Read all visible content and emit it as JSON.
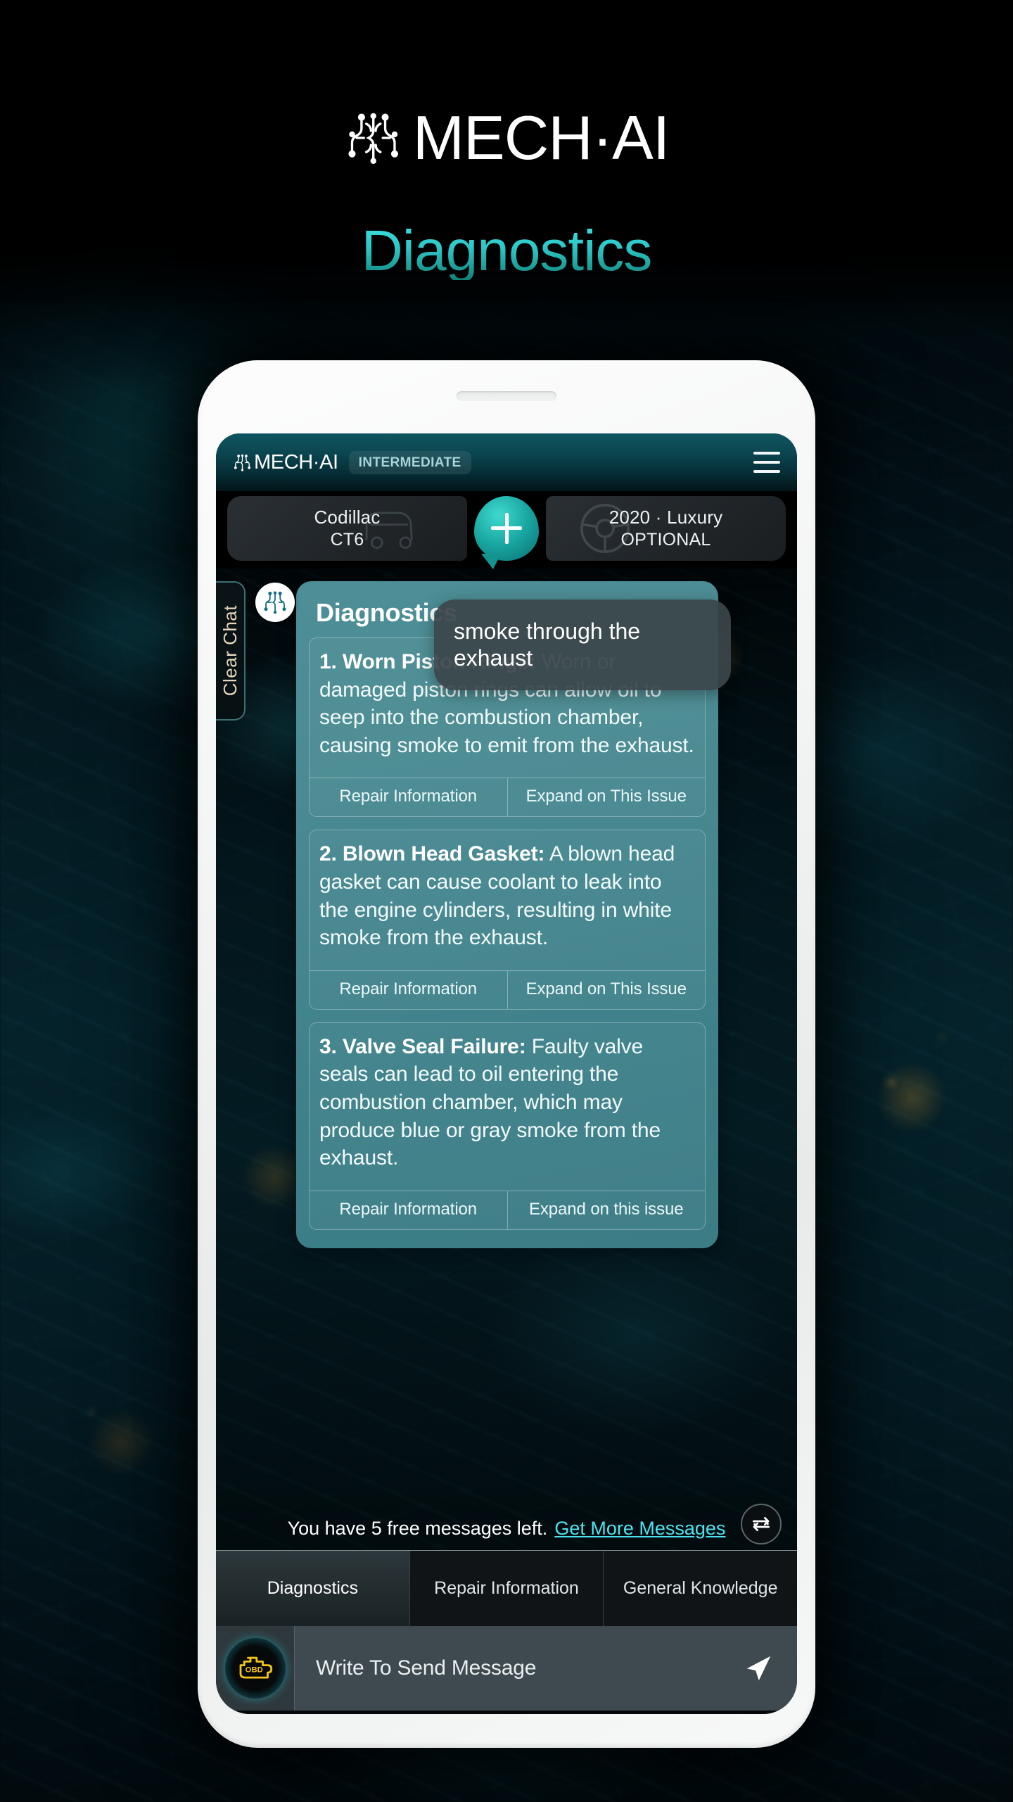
{
  "page": {
    "brand_name": "MECH·AI",
    "brand_icon": "circuit-logo-icon",
    "subtitle": "Diagnostics"
  },
  "app": {
    "header": {
      "logo_text": "MECH·AI",
      "logo_icon": "circuit-logo-icon",
      "level_badge": "INTERMEDIATE",
      "menu_icon": "hamburger-menu-icon"
    },
    "vehicle": {
      "make": "Codillac",
      "model": "CT6",
      "year_trim": "2020 · Luxury",
      "optional": "OPTIONAL",
      "add_icon": "plus-icon"
    },
    "chat": {
      "clear_chat_label": "Clear Chat",
      "avatar_icon": "circuit-logo-icon",
      "bot_title": "Diagnostics",
      "user_message": "smoke through the exhaust",
      "cards": [
        {
          "index": "1.",
          "title": "Worn Piston Rings:",
          "text": "Worn or damaged piston rings can allow oil to seep into the combustion chamber, causing smoke to emit from the exhaust.",
          "btn_left": "Repair Information",
          "btn_right": "Expand on This Issue"
        },
        {
          "index": "2.",
          "title": "Blown Head Gasket:",
          "text": "A blown head gasket can cause coolant to leak into the engine cylinders, resulting in white smoke from the exhaust.",
          "btn_left": "Repair Information",
          "btn_right": "Expand on This Issue"
        },
        {
          "index": "3.",
          "title": "Valve Seal Failure:",
          "text": "Faulty valve seals can lead to oil entering the combustion chamber, which may produce blue or gray smoke from the exhaust.",
          "btn_left": "Repair Information",
          "btn_right": "Expand on this issue"
        }
      ]
    },
    "quota": {
      "text": "You have 5 free messages left.",
      "link": "Get More Messages",
      "refresh_icon": "refresh-icon"
    },
    "tabs": [
      {
        "label": "Diagnostics",
        "active": true
      },
      {
        "label": "Repair Information",
        "active": false
      },
      {
        "label": "General Knowledge",
        "active": false
      }
    ],
    "composer": {
      "obd_icon": "obd-check-engine-icon",
      "obd_label": "OBD",
      "placeholder": "Write To Send Message",
      "send_icon": "send-icon"
    }
  },
  "colors": {
    "accent_teal": "#2ec8c8",
    "link_cyan": "#4ee2ef",
    "card_teal": "#4b8b93",
    "obd_yellow": "#f5c518"
  }
}
